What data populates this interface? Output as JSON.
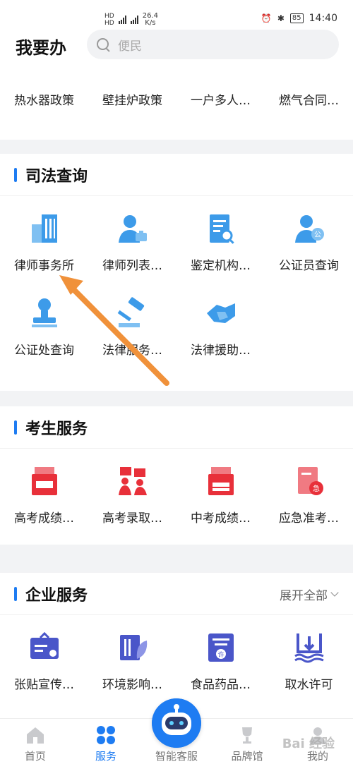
{
  "status_bar": {
    "speed": "26.4",
    "speed_unit": "K/s",
    "battery": "85",
    "time": "14:40"
  },
  "header": {
    "title": "我要办",
    "search_placeholder": "便民"
  },
  "top_row": [
    {
      "label": "热水器政策",
      "icon": "water-heater-icon"
    },
    {
      "label": "壁挂炉政策",
      "icon": "boiler-icon"
    },
    {
      "label": "一户多人…",
      "icon": "household-icon"
    },
    {
      "label": "燃气合同…",
      "icon": "gas-contract-icon"
    }
  ],
  "sections": {
    "judicial": {
      "title": "司法查询",
      "items": [
        {
          "label": "律师事务所",
          "icon": "law-firm-building-icon"
        },
        {
          "label": "律师列表…",
          "icon": "lawyer-icon"
        },
        {
          "label": "鉴定机构…",
          "icon": "appraisal-document-icon"
        },
        {
          "label": "公证员查询",
          "icon": "notary-person-icon"
        },
        {
          "label": "公证处查询",
          "icon": "notary-stamp-icon"
        },
        {
          "label": "法律服务…",
          "icon": "gavel-icon"
        },
        {
          "label": "法律援助…",
          "icon": "legal-aid-handshake-icon"
        }
      ]
    },
    "exam": {
      "title": "考生服务",
      "items": [
        {
          "label": "高考成绩…",
          "icon": "exam-score-icon"
        },
        {
          "label": "高考录取…",
          "icon": "admission-icon"
        },
        {
          "label": "中考成绩…",
          "icon": "middle-exam-score-icon"
        },
        {
          "label": "应急准考…",
          "icon": "emergency-ticket-icon"
        }
      ]
    },
    "enterprise": {
      "title": "企业服务",
      "action": "展开全部",
      "items": [
        {
          "label": "张贴宣传…",
          "icon": "poster-icon"
        },
        {
          "label": "环境影响…",
          "icon": "environment-icon"
        },
        {
          "label": "食品药品…",
          "icon": "food-drug-icon"
        },
        {
          "label": "取水许可",
          "icon": "water-permit-icon"
        }
      ]
    }
  },
  "bottom_nav": [
    {
      "label": "首页",
      "active": false
    },
    {
      "label": "服务",
      "active": true
    },
    {
      "label": "智能客服",
      "active": false
    },
    {
      "label": "品牌馆",
      "active": false
    },
    {
      "label": "我的",
      "active": false
    }
  ],
  "watermark": "Bai 经验",
  "colors": {
    "accent": "#1e7cf2",
    "judicial_icon": "#3d9be9",
    "exam_icon": "#e8303a",
    "enterprise_icon": "#4a56c9",
    "annotation_arrow": "#f0913a"
  }
}
